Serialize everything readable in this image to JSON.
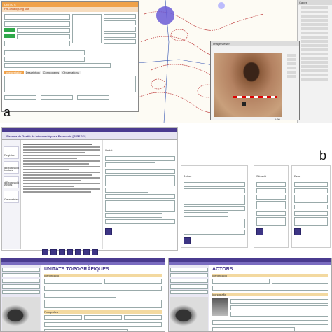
{
  "panel_a": {
    "label": "a",
    "form_title": "UNITATS",
    "form_subtitle": "Pre-cataloguing unit",
    "tabs": [
      "Interpretation",
      "Description",
      "Components",
      "Observations"
    ],
    "photo_caption": "Image viewer",
    "scale_text": "1:50",
    "legend_title": "Capes"
  },
  "panel_b": {
    "label": "b",
    "header": "Sistema de Gestió de Informació per a Excavació [SIGE 2.1]",
    "nav": [
      "Registre d'Excavació",
      "Unitats d'Excavació",
      "Actors",
      "Geometries"
    ],
    "form_labels": [
      "Unitat",
      "Actors",
      "Situació",
      "Estat"
    ]
  },
  "panel_c": {
    "left_title": "UNITATS TOPOGRÀFIQUES",
    "right_title": "ACTORS",
    "left_section": "Identificació",
    "right_section": "Identificació",
    "left_photo_section": "Fotografies",
    "right_photo_section": "Iconografia"
  },
  "colors": {
    "accent": "#4a3b8f",
    "orange": "#f0a24a",
    "map_red": "#c04040"
  }
}
